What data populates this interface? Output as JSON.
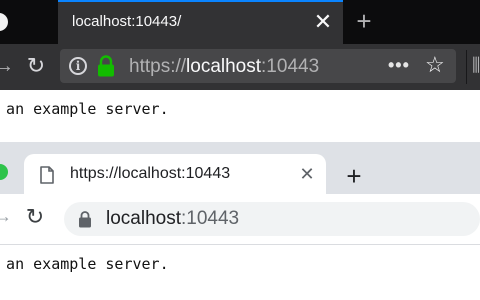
{
  "top_browser": {
    "tab": {
      "title": "localhost:10443/",
      "close_glyph": "✕"
    },
    "new_tab_glyph": "+",
    "toolbar": {
      "back_glyph": "→",
      "reload_glyph": "↻"
    },
    "urlbar": {
      "info_glyph": "i",
      "scheme": "https://",
      "host": "localhost",
      "port": ":10443",
      "more_glyph": "•••",
      "star_glyph": "☆"
    },
    "lock_color": "#12bc00",
    "page_text": "s an example server."
  },
  "bottom_browser": {
    "tab": {
      "title": "https://localhost:10443",
      "close_glyph": "✕"
    },
    "new_tab_glyph": "+",
    "toolbar": {
      "reload_glyph": "↻"
    },
    "omnibox": {
      "host": "localhost",
      "port": ":10443"
    },
    "page_text": "s an example server."
  }
}
